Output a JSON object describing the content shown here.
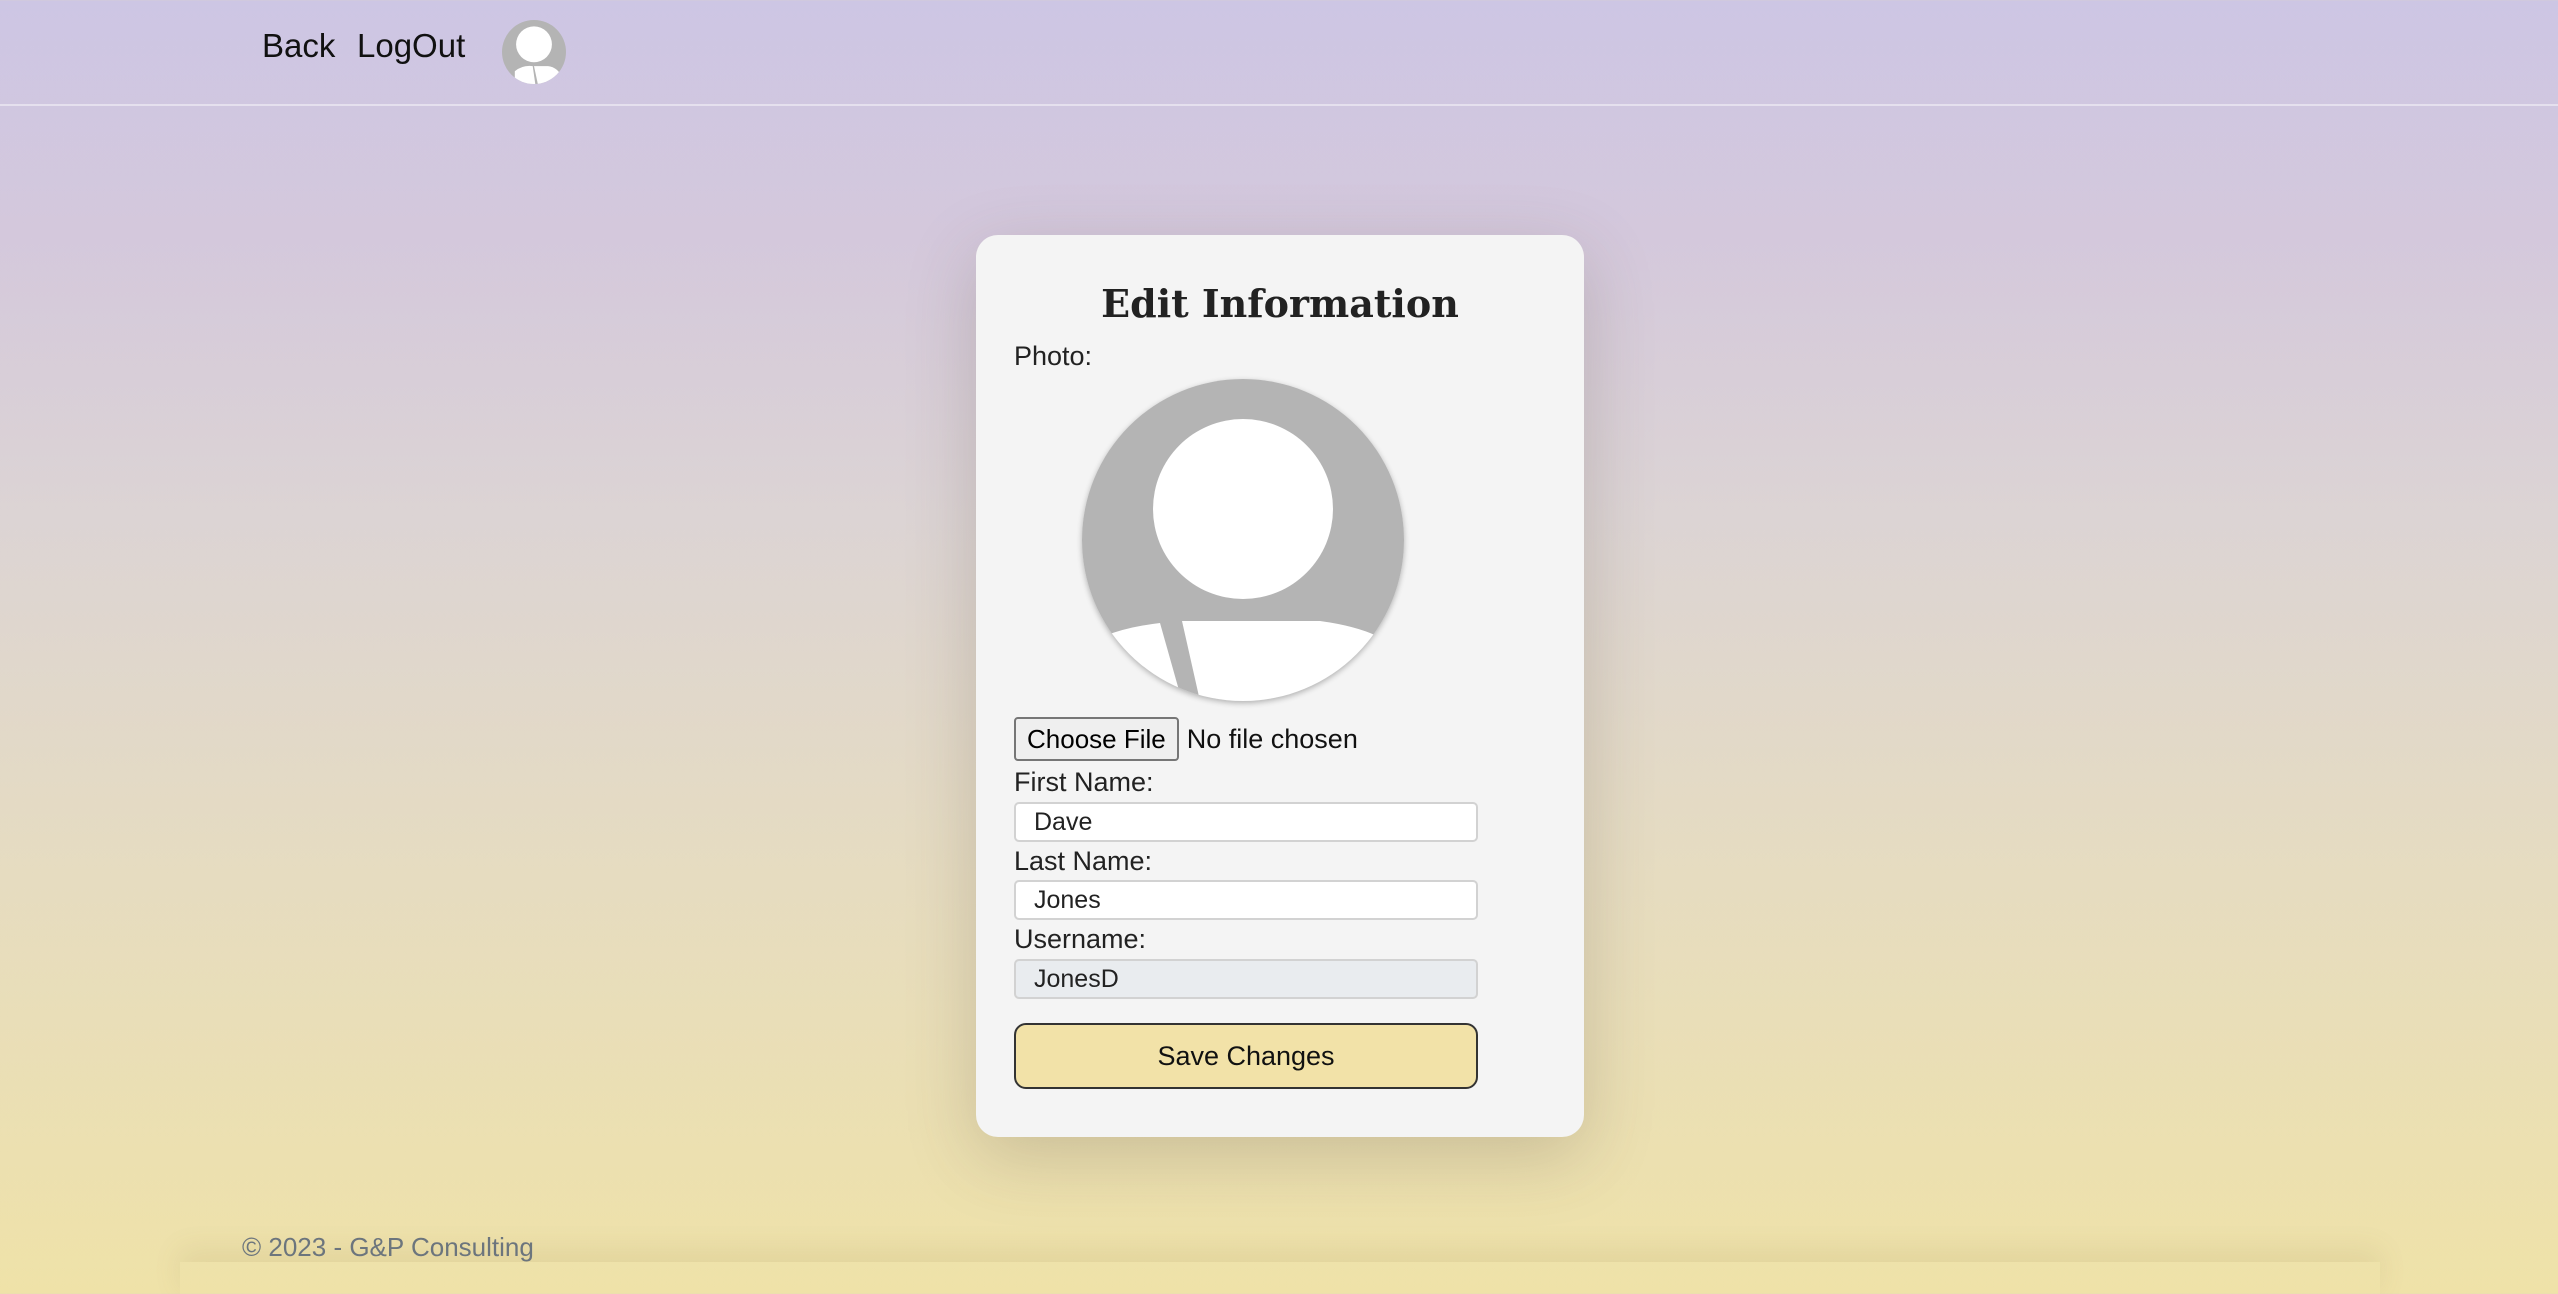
{
  "nav": {
    "back_label": "Back",
    "logout_label": "LogOut",
    "avatar_icon": "user-avatar-icon"
  },
  "form": {
    "title": "Edit Information",
    "photo_label": "Photo:",
    "photo_icon": "default-profile-photo-icon",
    "file_button_label": "Choose File",
    "file_status": "No file chosen",
    "first_name_label": "First Name:",
    "first_name_value": "Dave",
    "last_name_label": "Last Name:",
    "last_name_value": "Jones",
    "username_label": "Username:",
    "username_value": "JonesD",
    "save_label": "Save Changes"
  },
  "footer": {
    "copyright": "© 2023 - G&P Consulting"
  },
  "colors": {
    "gradient_top": "#cdc6e4",
    "gradient_bottom": "#efe2a8",
    "save_button": "#f2e2a8",
    "card_background": "#f4f4f4",
    "avatar_gray": "#b4b4b4"
  }
}
